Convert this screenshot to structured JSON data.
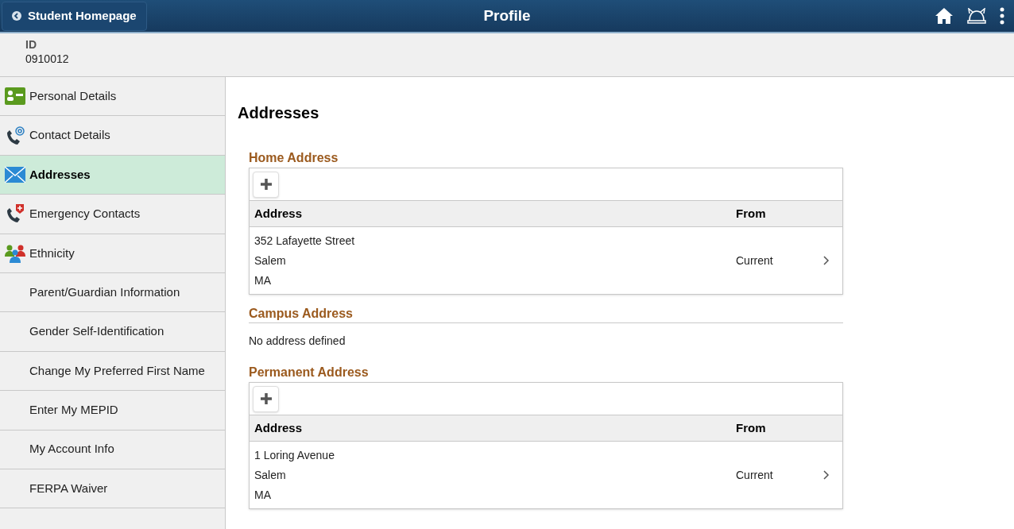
{
  "header": {
    "back_button": "Student Homepage",
    "title": "Profile"
  },
  "id_block": {
    "label": "ID",
    "value": "0910012"
  },
  "sidebar": {
    "items": [
      {
        "label": "Personal Details",
        "selected": false
      },
      {
        "label": "Contact Details",
        "selected": false
      },
      {
        "label": "Addresses",
        "selected": true
      },
      {
        "label": "Emergency Contacts",
        "selected": false
      },
      {
        "label": "Ethnicity",
        "selected": false
      },
      {
        "label": "Parent/Guardian Information",
        "selected": false
      },
      {
        "label": "Gender Self-Identification",
        "selected": false
      },
      {
        "label": "Change My Preferred First Name",
        "selected": false
      },
      {
        "label": "Enter My MEPID",
        "selected": false
      },
      {
        "label": "My Account Info",
        "selected": false
      },
      {
        "label": "FERPA Waiver",
        "selected": false
      }
    ]
  },
  "content": {
    "title": "Addresses",
    "sections": [
      {
        "kind": "table",
        "title": "Home Address",
        "columns": [
          "Address",
          "From"
        ],
        "rows": [
          {
            "address": [
              "352 Lafayette Street",
              "Salem",
              "MA"
            ],
            "from": "Current"
          }
        ]
      },
      {
        "kind": "empty",
        "title": "Campus Address",
        "message": "No address defined"
      },
      {
        "kind": "table",
        "title": "Permanent Address",
        "columns": [
          "Address",
          "From"
        ],
        "rows": [
          {
            "address": [
              "1 Loring Avenue",
              "Salem",
              "MA"
            ],
            "from": "Current"
          }
        ]
      }
    ]
  }
}
